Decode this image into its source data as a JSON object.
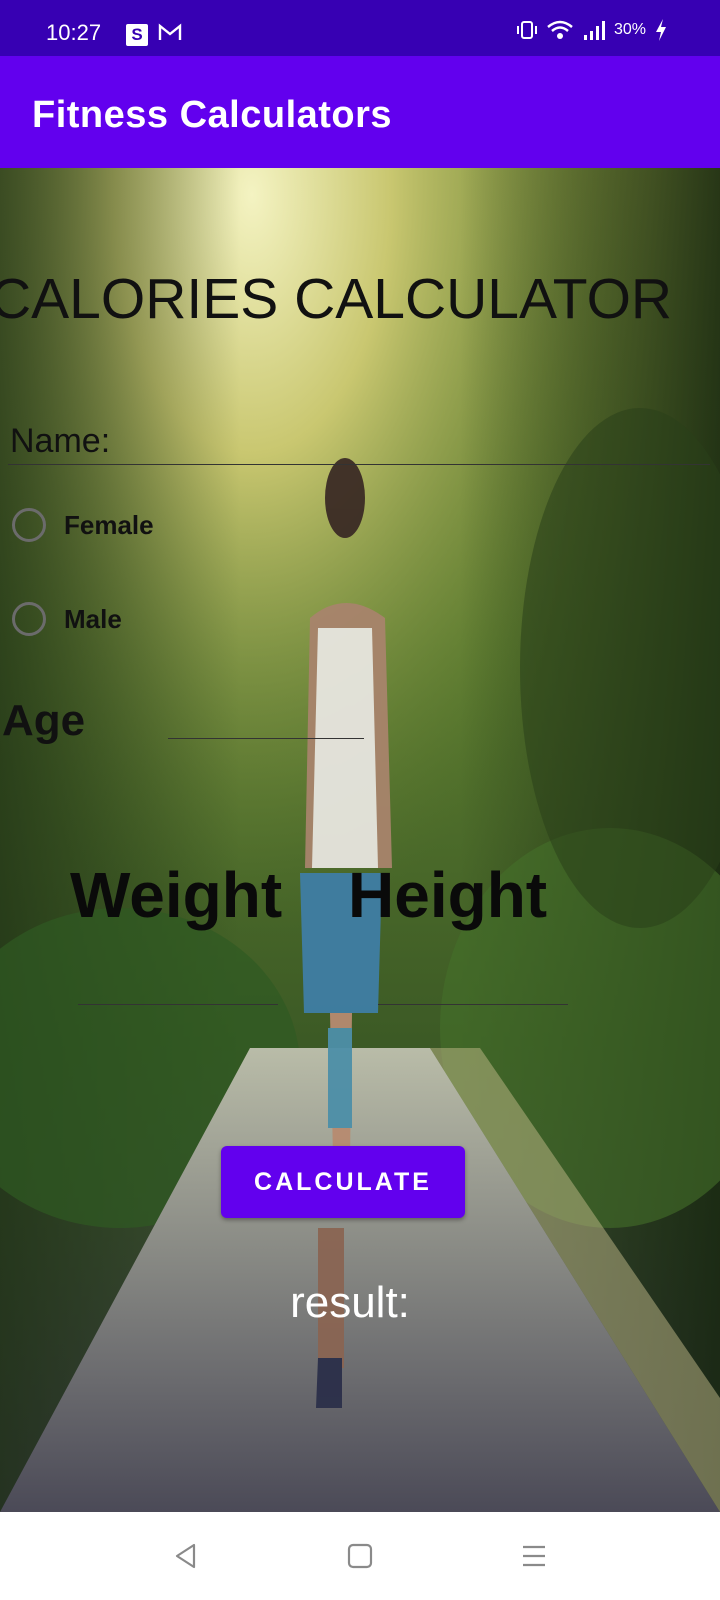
{
  "status_bar": {
    "time": "10:27",
    "s_icon_text": "S",
    "battery": "30%",
    "icons": [
      "s-app-icon",
      "gmail-icon",
      "vibrate-icon",
      "wifi-icon",
      "signal-icon",
      "battery-charging-icon"
    ]
  },
  "app_bar": {
    "title": "Fitness Calculators"
  },
  "form": {
    "heading": "CALORIES CALCULATOR",
    "name_placeholder": "Name:",
    "gender_options": [
      {
        "label": "Female",
        "selected": false
      },
      {
        "label": "Male",
        "selected": false
      }
    ],
    "age_label": "Age",
    "weight_label": "Weight",
    "height_label": "Height",
    "calculate_label": "CALCULATE",
    "result_label": "result:"
  },
  "nav_bar": {
    "icons": [
      "back-icon",
      "home-icon",
      "menu-icon"
    ]
  },
  "colors": {
    "status_bar": "#3700b3",
    "app_bar": "#6200ee",
    "button": "#6200ee"
  }
}
